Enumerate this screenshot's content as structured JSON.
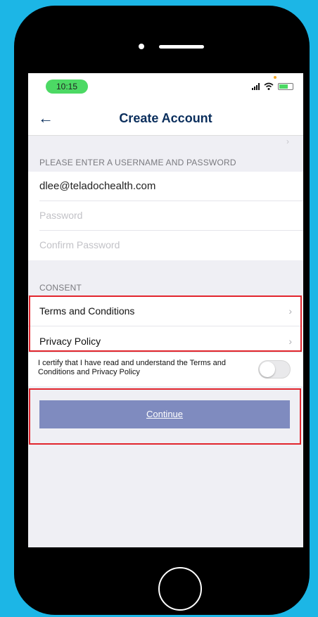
{
  "status_bar": {
    "time": "10:15"
  },
  "nav": {
    "back_icon": "back-arrow-icon",
    "title": "Create Account"
  },
  "credentials": {
    "header": "PLEASE ENTER A USERNAME AND PASSWORD",
    "username": "dlee@teladochealth.com",
    "password_placeholder": "Password",
    "confirm_placeholder": "Confirm Password"
  },
  "consent": {
    "header": "CONSENT",
    "items": [
      {
        "label": "Terms and Conditions"
      },
      {
        "label": "Privacy Policy"
      }
    ],
    "certify_text": "I certify that I have read and understand the Terms and Conditions and Privacy Policy",
    "certify_checked": false
  },
  "continue_label": "Continue",
  "colors": {
    "accent_green": "#4cd964",
    "nav_blue": "#0a2e5c",
    "button": "#7f8bbf",
    "highlight_red": "#e2252d",
    "background": "#1cb6e6"
  }
}
